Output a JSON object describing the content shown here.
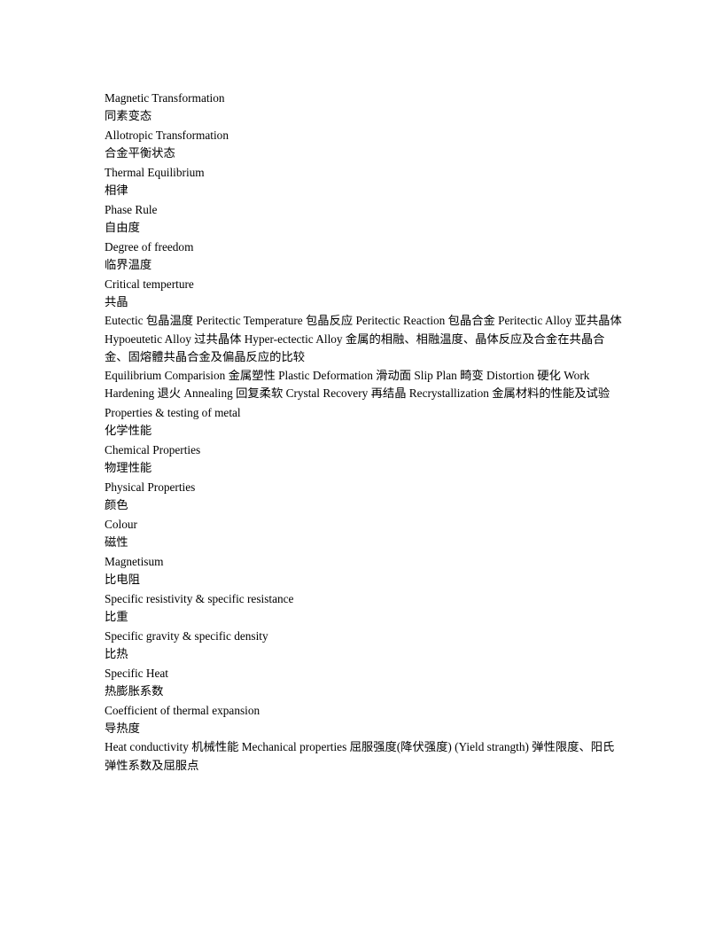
{
  "document": {
    "page_background": "#ffffff",
    "text_color": "#000000",
    "lines": [
      {
        "text": "Magnetic Transformation",
        "kind": "en"
      },
      {
        "text": "同素变态",
        "kind": "zh"
      },
      {
        "text": "Allotropic Transformation",
        "kind": "en"
      },
      {
        "text": "合金平衡状态",
        "kind": "zh"
      },
      {
        "text": "Thermal Equilibrium",
        "kind": "en"
      },
      {
        "text": "相律",
        "kind": "zh"
      },
      {
        "text": "Phase Rule",
        "kind": "en"
      },
      {
        "text": "自由度",
        "kind": "zh"
      },
      {
        "text": "Degree of freedom",
        "kind": "en"
      },
      {
        "text": "临界温度",
        "kind": "zh"
      },
      {
        "text": "Critical temperture",
        "kind": "en"
      },
      {
        "text": "共晶",
        "kind": "zh"
      },
      {
        "text": "Eutectic 包晶温度 Peritectic Temperature 包晶反应 Peritectic Reaction 包晶合金 Peritectic Alloy 亚共晶体 Hypoeutetic Alloy 过共晶体 Hyper-ectectic Alloy 金属的相融、相融温度、晶体反应及合金在共晶合金、固熔體共晶合金及偏晶反应的比较",
        "kind": "mixed"
      },
      {
        "text": "Equilibrium Comparision 金属塑性 Plastic Deformation 滑动面 Slip Plan 畸变 Distortion 硬化 Work Hardening 退火 Annealing 回复柔软 Crystal Recovery 再结晶 Recrystallization 金属材料的性能及试验",
        "kind": "mixed"
      },
      {
        "text": "Properties & testing of metal",
        "kind": "en"
      },
      {
        "text": "化学性能",
        "kind": "zh"
      },
      {
        "text": "Chemical Properties",
        "kind": "en"
      },
      {
        "text": "物理性能",
        "kind": "zh"
      },
      {
        "text": "Physical Properties",
        "kind": "en"
      },
      {
        "text": "颜色",
        "kind": "zh"
      },
      {
        "text": "Colour",
        "kind": "en"
      },
      {
        "text": "磁性",
        "kind": "zh"
      },
      {
        "text": "Magnetisum",
        "kind": "en"
      },
      {
        "text": "比电阻",
        "kind": "zh"
      },
      {
        "text": "Specific resistivity & specific resistance",
        "kind": "en"
      },
      {
        "text": "比重",
        "kind": "zh"
      },
      {
        "text": "Specific gravity & specific density",
        "kind": "en"
      },
      {
        "text": "比热",
        "kind": "zh"
      },
      {
        "text": "Specific Heat",
        "kind": "en"
      },
      {
        "text": "热膨胀系数",
        "kind": "zh"
      },
      {
        "text": "Coefficient of thermal expansion",
        "kind": "en"
      },
      {
        "text": "导热度",
        "kind": "zh"
      },
      {
        "text": "Heat conductivity 机械性能 Mechanical properties 屈服强度(降伏强度) (Yield strangth) 弹性限度、阳氏弹性系数及屈服点",
        "kind": "mixed"
      }
    ]
  }
}
